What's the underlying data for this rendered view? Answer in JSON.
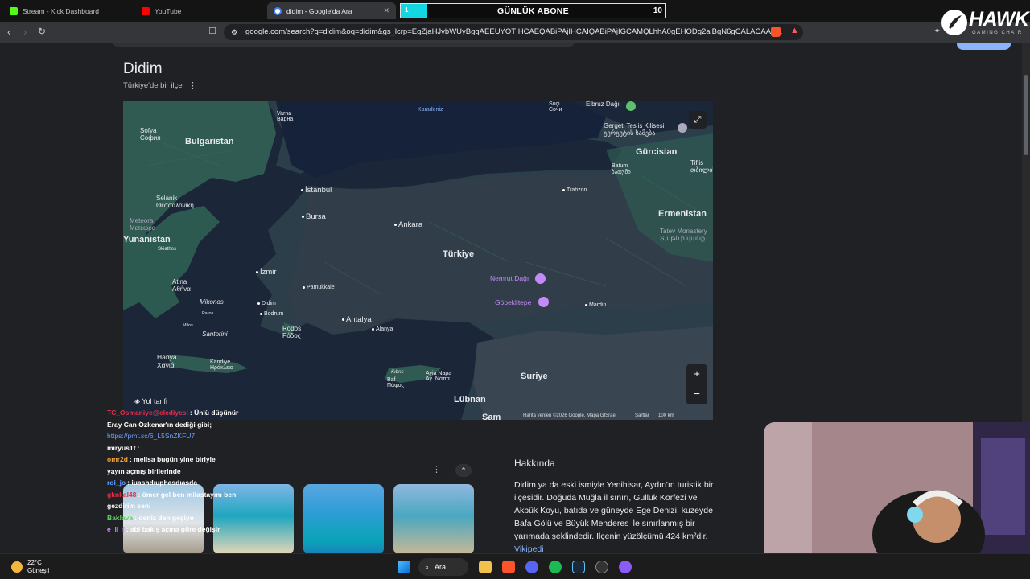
{
  "tabs": [
    {
      "label": "Stream - Kick Dashboard",
      "active": false
    },
    {
      "label": "YouTube",
      "active": false
    },
    {
      "label": "didim - Google'da Ara",
      "active": true
    }
  ],
  "overlay": {
    "sub_current": "1",
    "sub_label": "GÜNLÜK ABONE",
    "sub_goal": "10",
    "sub_progress": 0.1
  },
  "logo": {
    "word": "HAWK",
    "sub": "GAMING CHAIR"
  },
  "url": "google.com/search?q=didim&oq=didim&gs_lcrp=EgZjaHJvbWUyBggAEEUYOTIHCAEQABiPAjIHCAIQABiPAjIGCAMQLhhA0gEHODg2ajBqN6gCALACAA&...",
  "page": {
    "title": "Didim",
    "subtitle": "Türkiye'de bir ilçe",
    "directions": "Yol tarifi",
    "map_attribution": "Harita verileri ©2026 Google, Mapa GISrael",
    "map_terms": "Şartlar",
    "map_scale": "100 km",
    "about_heading": "Hakkında",
    "about_text": "Didim ya da eski ismiyle Yenihisar, Aydın'ın turistik bir ilçesidir. Doğuda Muğla il sınırı, Güllük Körfezi ve Akbük Koyu, batıda ve güneyde Ege Denizi, kuzeyde Bafa Gölü ve Büyük Menderes ile sınırlanmış bir yarımada şeklindedir. İlçenin yüzölçümü 424 km²dir.",
    "about_link": "Vikipedi"
  },
  "map_labels": [
    {
      "name": "bulgaristan",
      "text": "Bulgaristan",
      "kind": "big"
    },
    {
      "name": "sofya",
      "text": "Sofya\nСофия",
      "kind": "city"
    },
    {
      "name": "karadeniz",
      "text": "Karadeniz",
      "kind": "sea"
    },
    {
      "name": "varna",
      "text": "Varna\nВарна",
      "kind": "city"
    },
    {
      "name": "sochi",
      "text": "Soçi\nСочи",
      "kind": "city"
    },
    {
      "name": "elbruz",
      "text": "Elbruz Dağı",
      "kind": "city"
    },
    {
      "name": "gergeti",
      "text": "Gergeti Teslis Kilisesi\nგერგეტის სამება",
      "kind": "city"
    },
    {
      "name": "gurcistan",
      "text": "Gürcistan",
      "kind": "big"
    },
    {
      "name": "batum",
      "text": "Batum\nბათუმი",
      "kind": "city"
    },
    {
      "name": "tiflis",
      "text": "Tiflis\nთბილისი",
      "kind": "city"
    },
    {
      "name": "istanbul",
      "text": "İstanbul",
      "kind": "city"
    },
    {
      "name": "trabzon",
      "text": "Trabzon",
      "kind": "city"
    },
    {
      "name": "selanik",
      "text": "Selanik\nΘεσσαλονίκη",
      "kind": "city"
    },
    {
      "name": "bursa",
      "text": "Bursa",
      "kind": "city"
    },
    {
      "name": "ankara",
      "text": "Ankara",
      "kind": "city"
    },
    {
      "name": "ermenistan",
      "text": "Ermenistan",
      "kind": "big"
    },
    {
      "name": "meteora",
      "text": "Meteora\nΜετέωρα",
      "kind": "city"
    },
    {
      "name": "yunanistan",
      "text": "Yunanistan",
      "kind": "big"
    },
    {
      "name": "tatev",
      "text": "Tatev Monastery\nՏաթևի վանք",
      "kind": "city"
    },
    {
      "name": "skiathos",
      "text": "Skiathos",
      "kind": "small"
    },
    {
      "name": "turkiye",
      "text": "Türkiye",
      "kind": "big"
    },
    {
      "name": "izmir",
      "text": "İzmir",
      "kind": "city"
    },
    {
      "name": "pamukkale",
      "text": "Pamukkale",
      "kind": "city"
    },
    {
      "name": "nemrut",
      "text": "Nemrut Dağı",
      "kind": "poi"
    },
    {
      "name": "atina",
      "text": "Atina\nΑθήνα",
      "kind": "city"
    },
    {
      "name": "mikonos",
      "text": "Mikonos",
      "kind": "city"
    },
    {
      "name": "didim",
      "text": "Didim",
      "kind": "city"
    },
    {
      "name": "gobeklitepe",
      "text": "Göbeklitepe",
      "kind": "poi"
    },
    {
      "name": "mardin",
      "text": "Mardin",
      "kind": "city"
    },
    {
      "name": "paros",
      "text": "Paros",
      "kind": "small"
    },
    {
      "name": "bodrum",
      "text": "Bodrum",
      "kind": "city"
    },
    {
      "name": "antalya",
      "text": "Antalya",
      "kind": "city"
    },
    {
      "name": "milos",
      "text": "Milos",
      "kind": "small"
    },
    {
      "name": "rodos",
      "text": "Rodos\nΡόδος",
      "kind": "city"
    },
    {
      "name": "alanya",
      "text": "Alanya",
      "kind": "city"
    },
    {
      "name": "santorini",
      "text": "Santorini",
      "kind": "city"
    },
    {
      "name": "hanya",
      "text": "Hanya\nΧανιά",
      "kind": "city"
    },
    {
      "name": "kandiye",
      "text": "Kandiye\nΗράκλειο",
      "kind": "city"
    },
    {
      "name": "kibris",
      "text": "Kıbrıs",
      "kind": "small"
    },
    {
      "name": "aya-napa",
      "text": "Ayia Napa\nΑγ. Νάπα",
      "kind": "city"
    },
    {
      "name": "baf",
      "text": "Baf\nΠάφος",
      "kind": "city"
    },
    {
      "name": "suriye",
      "text": "Suriye",
      "kind": "big"
    },
    {
      "name": "lubnan",
      "text": "Lübnan",
      "kind": "big"
    },
    {
      "name": "sam",
      "text": "Şam",
      "kind": "big"
    }
  ],
  "chat": [
    {
      "user": "TC_Osmaniye@elediyesi",
      "user_color": "#e0304a",
      "text": ": Ünlü düşünür"
    },
    {
      "user": "",
      "user_color": "#fff",
      "text": "Eray Can Özkenar'ın dediği gibi;"
    },
    {
      "user": "",
      "user_color": "#fff",
      "text": "https://pmt.sc/6_L5SnZKFU7",
      "link": true
    },
    {
      "user": "miryus1f",
      "user_color": "#fff",
      "text": ":"
    },
    {
      "user": "omr2d",
      "user_color": "#f1a33b",
      "text": ": melisa bugün yine biriyle"
    },
    {
      "user": "",
      "user_color": "#fff",
      "text": "yayın açmış birilerinde"
    },
    {
      "user": "roi_jo",
      "user_color": "#6aa0ff",
      "text": ": iuashdıuphasdıasda"
    },
    {
      "user": "gknkal48",
      "user_color": "#e0304a",
      "text": ": ömer gel ben milastayım ben"
    },
    {
      "user": "",
      "user_color": "#fff",
      "text": "gezdirim seni"
    },
    {
      "user": "Baklava",
      "user_color": "#5fd35f",
      "text": ": deniz den geçiyo"
    },
    {
      "user": "e_li_f",
      "user_color": "#c58af9",
      "text": ": abi bakış açına göre değişir"
    }
  ],
  "taskbar": {
    "temp": "22°C",
    "weather": "Güneşli",
    "search": "Ara"
  },
  "colors": {
    "accent": "#14d6e3",
    "map_land": "#2c3a4a",
    "map_sea": "#16213a",
    "link": "#8ab4f8"
  }
}
